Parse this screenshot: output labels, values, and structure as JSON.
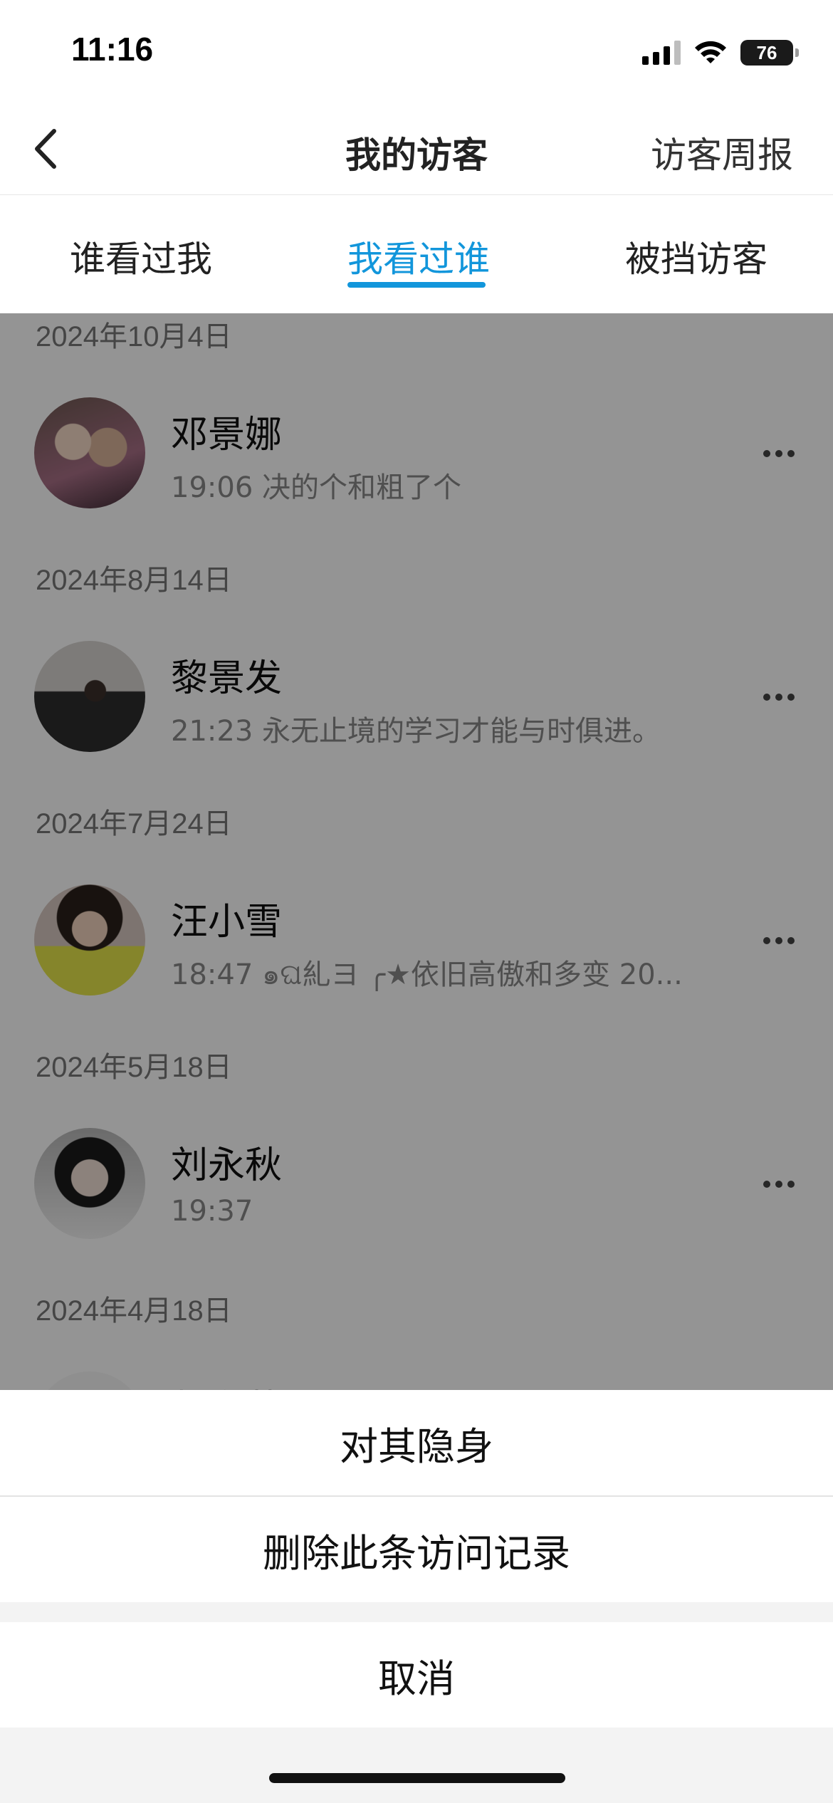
{
  "status_bar": {
    "time": "11:16",
    "battery": "76"
  },
  "nav": {
    "title": "我的访客",
    "right_action": "访客周报"
  },
  "tabs": {
    "items": [
      "谁看过我",
      "我看过谁",
      "被挡访客"
    ],
    "active_index": 1
  },
  "visitors": [
    {
      "date": "2024年10月4日",
      "name": "邓景娜",
      "desc": "19:06 决的个和粗了个"
    },
    {
      "date": "2024年8月14日",
      "name": "黎景发",
      "desc": "21:23 永无止境的学习才能与时俱进。"
    },
    {
      "date": "2024年7月24日",
      "name": "汪小雪",
      "desc": "18:47 ๑ଘ糺ヨ ╭★依旧高傲和多变 20..."
    },
    {
      "date": "2024年5月18日",
      "name": "刘永秋",
      "desc": "19:37"
    },
    {
      "date": "2024年4月18日",
      "name": "胡春英",
      "desc": ""
    }
  ],
  "action_sheet": {
    "hide": "对其隐身",
    "delete": "删除此条访问记录",
    "cancel": "取消"
  },
  "colors": {
    "accent": "#1296db",
    "overlay": "rgba(0,0,0,0.42)"
  },
  "icons": [
    "back-chevron-icon",
    "signal-icon",
    "wifi-icon",
    "battery-icon",
    "more-dots-icon"
  ]
}
